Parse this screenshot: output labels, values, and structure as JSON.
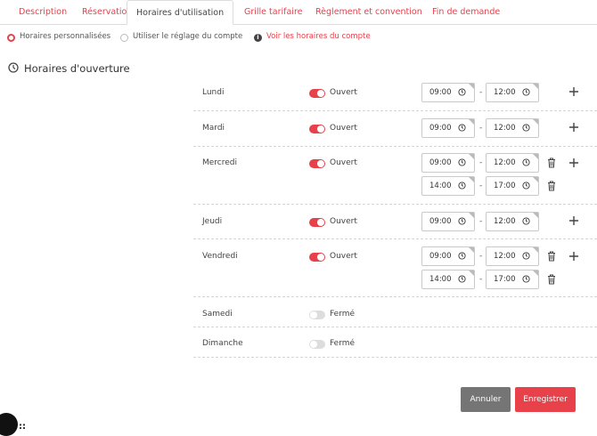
{
  "tabs": [
    {
      "label": "Description",
      "active": false
    },
    {
      "label": "Réservation",
      "active": false
    },
    {
      "label": "Horaires d'utilisation",
      "active": true
    },
    {
      "label": "Grille tarifaire",
      "active": false
    },
    {
      "label": "Règlement et convention",
      "active": false
    },
    {
      "label": "Fin de demande",
      "active": false
    }
  ],
  "mode": {
    "custom_label": "Horaires personnalisées",
    "custom_selected": true,
    "account_label": "Utiliser le réglage du compte",
    "account_selected": false,
    "view_link": "Voir les horaires du compte"
  },
  "section": {
    "title": "Horaires d'ouverture"
  },
  "days": [
    {
      "name": "Lundi",
      "open": true,
      "status": "Ouvert",
      "ranges": [
        {
          "start": "09:00",
          "end": "12:00"
        }
      ]
    },
    {
      "name": "Mardi",
      "open": true,
      "status": "Ouvert",
      "ranges": [
        {
          "start": "09:00",
          "end": "12:00"
        }
      ]
    },
    {
      "name": "Mercredi",
      "open": true,
      "status": "Ouvert",
      "ranges": [
        {
          "start": "09:00",
          "end": "12:00"
        },
        {
          "start": "14:00",
          "end": "17:00"
        }
      ]
    },
    {
      "name": "Jeudi",
      "open": true,
      "status": "Ouvert",
      "ranges": [
        {
          "start": "09:00",
          "end": "12:00"
        }
      ]
    },
    {
      "name": "Vendredi",
      "open": true,
      "status": "Ouvert",
      "ranges": [
        {
          "start": "09:00",
          "end": "12:00"
        },
        {
          "start": "14:00",
          "end": "17:00"
        }
      ]
    },
    {
      "name": "Samedi",
      "open": false,
      "status": "Fermé",
      "ranges": []
    },
    {
      "name": "Dimanche",
      "open": false,
      "status": "Fermé",
      "ranges": []
    }
  ],
  "range_separator": "-",
  "actions": {
    "cancel": "Annuler",
    "save": "Enregistrer"
  },
  "footer_fragment": "::",
  "colors": {
    "accent": "#e8414a",
    "cancel": "#757575"
  }
}
